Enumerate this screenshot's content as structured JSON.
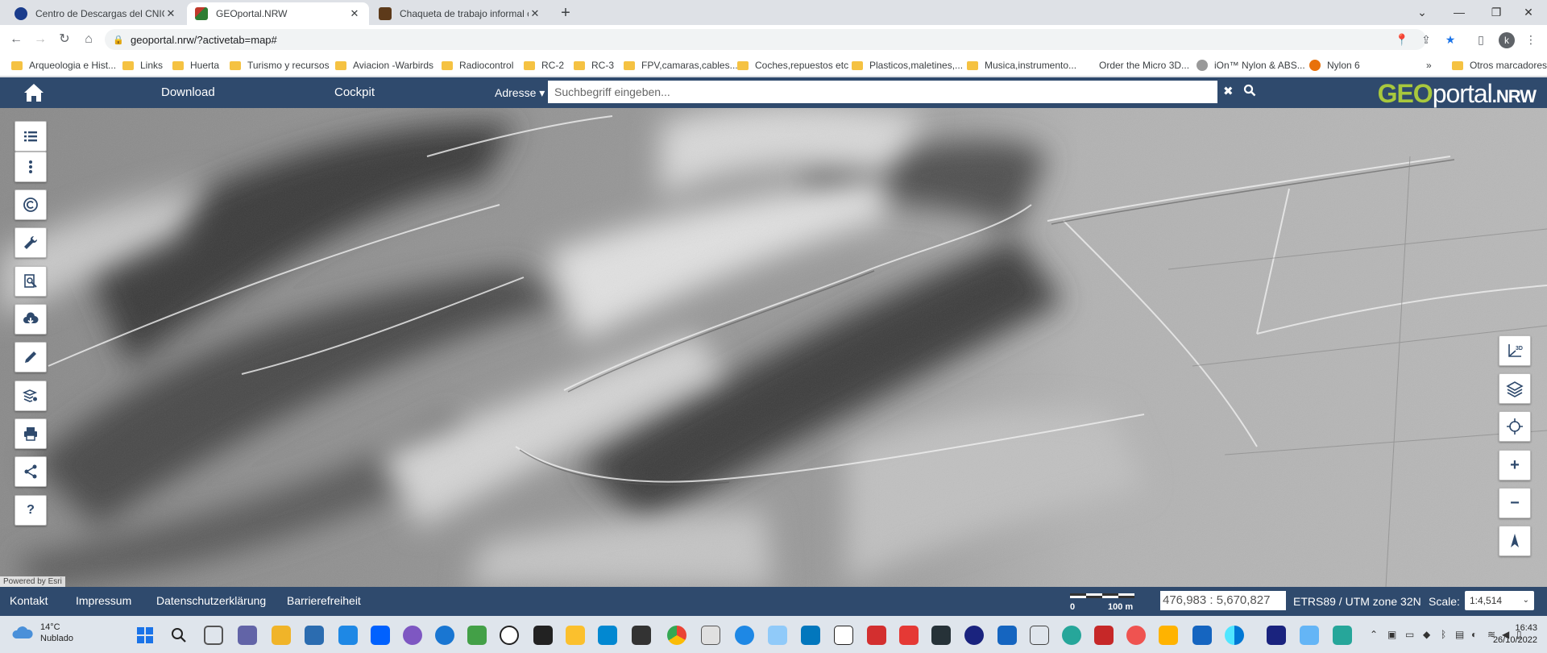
{
  "browser": {
    "tabs": [
      {
        "title": "Centro de Descargas del CNIG (I",
        "active": false
      },
      {
        "title": "GEOportal.NRW",
        "active": true
      },
      {
        "title": "Chaqueta de trabajo informal cál",
        "active": false
      }
    ],
    "new_tab": "+",
    "window_controls": {
      "minimize": "—",
      "maximize": "❐",
      "close": "✕",
      "tab_search": "⌄"
    },
    "url": "geoportal.nrw/?activetab=map#",
    "profile_initial": "k",
    "bookmarks": [
      "Arqueologia e Hist...",
      "Links",
      "Huerta",
      "Turismo y recursos",
      "Aviacion -Warbirds",
      "Radiocontrol",
      "RC-2",
      "RC-3",
      "FPV,camaras,cables...",
      "Coches,repuestos etc",
      "Plasticos,maletines,...",
      "Musica,instrumento...",
      "Order the Micro 3D...",
      "iOn™ Nylon & ABS...",
      "Nylon 6"
    ],
    "bookmarks_overflow": "»",
    "other_bookmarks": "Otros marcadores"
  },
  "header": {
    "nav": [
      "Download",
      "Cockpit"
    ],
    "address_dropdown": "Adresse ▾",
    "search_placeholder": "Suchbegriff eingeben...",
    "clear_icon": "✖",
    "search_icon": "🔍",
    "logo_geo": "GEO",
    "logo_portal": "portal",
    "logo_nrw": ".NRW"
  },
  "map": {
    "attribution": "Powered by Esri",
    "left_tools": [
      {
        "name": "themes-list-icon",
        "glyph": "☰"
      },
      {
        "name": "more-menu-icon",
        "glyph": "⋮"
      },
      {
        "name": "copyright-icon",
        "glyph": "©"
      },
      {
        "name": "tools-wrench-icon",
        "glyph": "🔧"
      },
      {
        "name": "search-document-icon",
        "glyph": "🔍"
      },
      {
        "name": "cloud-download-icon",
        "glyph": "☁"
      },
      {
        "name": "pencil-draw-icon",
        "glyph": "✎"
      },
      {
        "name": "layer-settings-icon",
        "glyph": "≋"
      },
      {
        "name": "print-icon",
        "glyph": "⎙"
      },
      {
        "name": "share-icon",
        "glyph": "⋖"
      },
      {
        "name": "help-icon",
        "glyph": "?"
      }
    ],
    "right_tools": [
      {
        "name": "3d-view-icon",
        "glyph": "3D"
      },
      {
        "name": "layers-icon",
        "glyph": "◈"
      },
      {
        "name": "locate-icon",
        "glyph": "⌖"
      },
      {
        "name": "zoom-in-icon",
        "glyph": "+"
      },
      {
        "name": "zoom-out-icon",
        "glyph": "−"
      },
      {
        "name": "north-arrow-icon",
        "glyph": "⬆"
      }
    ]
  },
  "footer": {
    "links": [
      "Kontakt",
      "Impressum",
      "Datenschutzerklärung",
      "Barrierefreiheit"
    ],
    "scalebar_start": "0",
    "scalebar_end": "100 m",
    "coordinates": "476,983 : 5,670,827",
    "crs": "ETRS89 / UTM zone 32N",
    "scale_label": "Scale:",
    "scale_value": "1:4,514"
  },
  "taskbar": {
    "weather_temp": "14°C",
    "weather_desc": "Nublado",
    "time": "16:43",
    "date": "26/10/2022"
  }
}
